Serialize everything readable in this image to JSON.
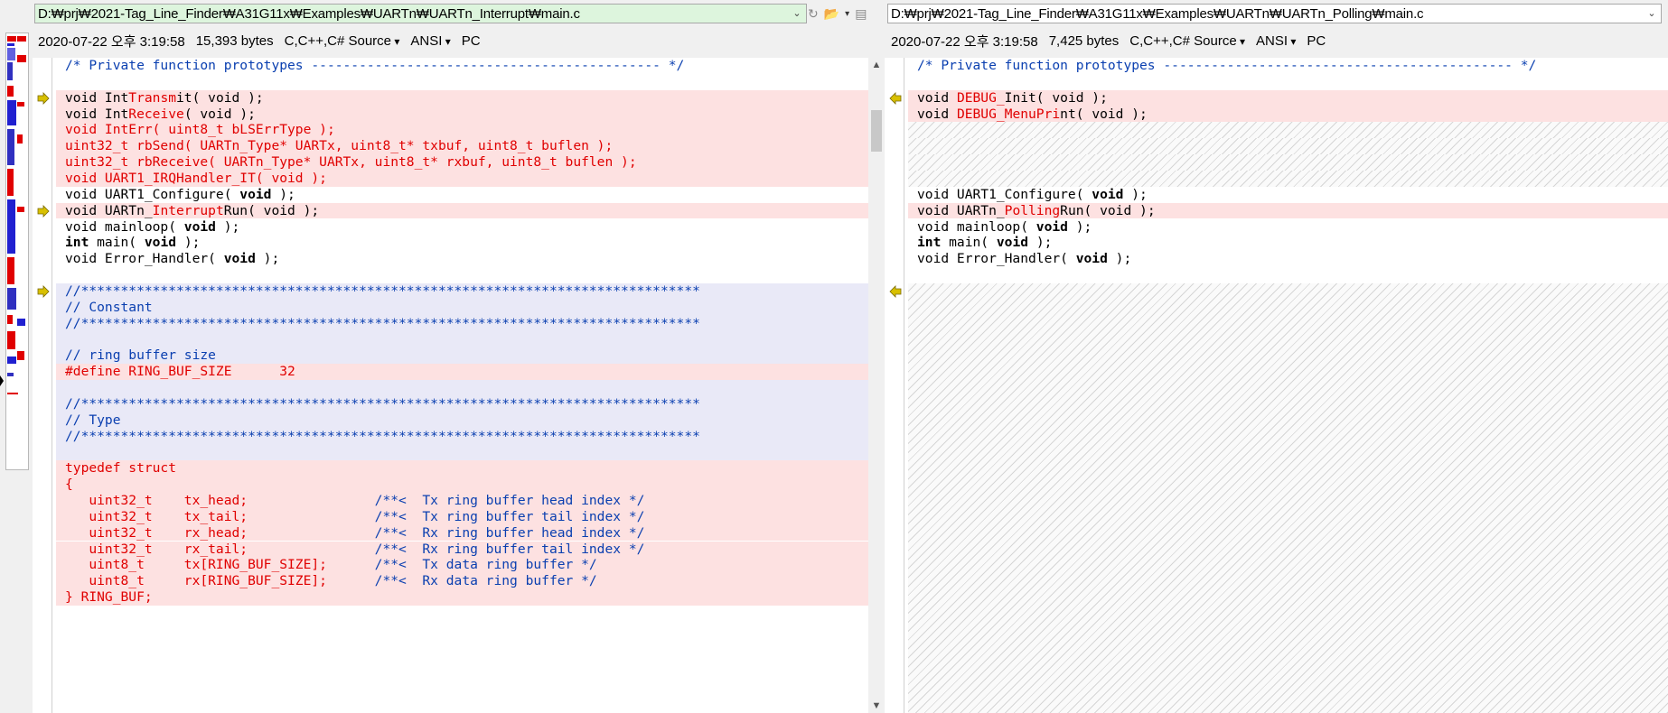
{
  "left": {
    "path": "D:₩prj₩2021-Tag_Line_Finder₩A31G11x₩Examples₩UARTn₩UARTn_Interrupt₩main.c",
    "info": {
      "datetime": "2020-07-22 오후 3:19:58",
      "size": "15,393 bytes",
      "filetype": "C,C++,C# Source",
      "encoding": "ANSI",
      "eol": "PC"
    },
    "lines": [
      {
        "text": "/* Private function prototypes -------------------------------------------- */",
        "color": "#0a3fb0",
        "bg": ""
      },
      {
        "text": "",
        "color": "",
        "bg": ""
      },
      {
        "text": "void IntTransmit( void );",
        "color": "mixed1",
        "bg": "red",
        "marker": "right"
      },
      {
        "text": "void IntReceive( void );",
        "color": "mixed2",
        "bg": "red"
      },
      {
        "text": "void IntErr( uint8_t bLSErrType );",
        "color": "#e00000",
        "bg": "red"
      },
      {
        "text": "uint32_t rbSend( UARTn_Type* UARTx, uint8_t* txbuf, uint8_t buflen );",
        "color": "#e00000",
        "bg": "red"
      },
      {
        "text": "uint32_t rbReceive( UARTn_Type* UARTx, uint8_t* rxbuf, uint8_t buflen );",
        "color": "#e00000",
        "bg": "red"
      },
      {
        "text": "void UART1_IRQHandler_IT( void );",
        "color": "#e00000",
        "bg": "red"
      },
      {
        "text": "void UART1_Configure( void );",
        "color": "kwvoid",
        "bg": ""
      },
      {
        "text": "void UARTn_InterruptRun( void );",
        "color": "mixed3",
        "bg": "red",
        "marker": "right"
      },
      {
        "text": "void mainloop( void );",
        "color": "kwvoid",
        "bg": ""
      },
      {
        "text": "int main( void );",
        "color": "kwint",
        "bg": ""
      },
      {
        "text": "void Error_Handler( void );",
        "color": "kwvoid",
        "bg": ""
      },
      {
        "text": "",
        "color": "",
        "bg": ""
      },
      {
        "text": "//******************************************************************************",
        "color": "#0a3fb0",
        "bg": "blue",
        "marker": "right"
      },
      {
        "text": "// Constant",
        "color": "#0a3fb0",
        "bg": "blue"
      },
      {
        "text": "//******************************************************************************",
        "color": "#0a3fb0",
        "bg": "blue"
      },
      {
        "text": "",
        "color": "",
        "bg": "blue"
      },
      {
        "text": "// ring buffer size",
        "color": "#0a3fb0",
        "bg": "blue"
      },
      {
        "text": "#define RING_BUF_SIZE      32",
        "color": "#e00000",
        "bg": "red"
      },
      {
        "text": "",
        "color": "",
        "bg": "blue"
      },
      {
        "text": "//******************************************************************************",
        "color": "#0a3fb0",
        "bg": "blue"
      },
      {
        "text": "// Type",
        "color": "#0a3fb0",
        "bg": "blue"
      },
      {
        "text": "//******************************************************************************",
        "color": "#0a3fb0",
        "bg": "blue"
      },
      {
        "text": "",
        "color": "",
        "bg": "blue"
      },
      {
        "text": "typedef struct",
        "color": "#e00000",
        "bg": "red"
      },
      {
        "text": "{",
        "color": "#e00000",
        "bg": "red"
      },
      {
        "text": "   uint32_t    tx_head;                /**<  Tx ring buffer head index */",
        "color": "split",
        "bg": "red"
      },
      {
        "text": "   uint32_t    tx_tail;                /**<  Tx ring buffer tail index */",
        "color": "split",
        "bg": "red"
      },
      {
        "text": "   uint32_t    rx_head;                /**<  Rx ring buffer head index */",
        "color": "split",
        "bg": "red"
      },
      {
        "text": "   uint32_t    rx_tail;                /**<  Rx ring buffer tail index */",
        "color": "split",
        "bg": "red"
      },
      {
        "text": "   uint8_t     tx[RING_BUF_SIZE];      /**<  Tx data ring buffer */",
        "color": "split",
        "bg": "red"
      },
      {
        "text": "   uint8_t     rx[RING_BUF_SIZE];      /**<  Rx data ring buffer */",
        "color": "split",
        "bg": "red"
      },
      {
        "text": "} RING_BUF;",
        "color": "#e00000",
        "bg": "red"
      },
      {
        "text": "",
        "color": "",
        "bg": ""
      }
    ]
  },
  "right": {
    "path": "D:₩prj₩2021-Tag_Line_Finder₩A31G11x₩Examples₩UARTn₩UARTn_Polling₩main.c",
    "info": {
      "datetime": "2020-07-22 오후 3:19:58",
      "size": "7,425 bytes",
      "filetype": "C,C++,C# Source",
      "encoding": "ANSI",
      "eol": "PC"
    },
    "lines": [
      {
        "text": "/* Private function prototypes -------------------------------------------- */",
        "color": "#0a3fb0",
        "bg": ""
      },
      {
        "text": "",
        "color": "",
        "bg": ""
      },
      {
        "text": "void DEBUG_Init( void );",
        "color": "mixedR1",
        "bg": "red",
        "marker": "left"
      },
      {
        "text": "void DEBUG_MenuPrint( void );",
        "color": "mixedR2",
        "bg": "red"
      },
      {
        "text": "",
        "color": "",
        "bg": "hatch"
      },
      {
        "text": "",
        "color": "",
        "bg": "hatch"
      },
      {
        "text": "",
        "color": "",
        "bg": "hatch"
      },
      {
        "text": "",
        "color": "",
        "bg": "hatch"
      },
      {
        "text": "void UART1_Configure( void );",
        "color": "kwvoid",
        "bg": ""
      },
      {
        "text": "void UARTn_PollingRun( void );",
        "color": "mixedR3",
        "bg": "red"
      },
      {
        "text": "void mainloop( void );",
        "color": "kwvoid",
        "bg": ""
      },
      {
        "text": "int main( void );",
        "color": "kwint",
        "bg": ""
      },
      {
        "text": "void Error_Handler( void );",
        "color": "kwvoid",
        "bg": ""
      },
      {
        "text": "",
        "color": "",
        "bg": ""
      },
      {
        "text": "",
        "color": "",
        "bg": "hatch",
        "marker": "left"
      }
    ]
  },
  "colors": {
    "comment": "#0a3fb0",
    "diff_text": "#e00000",
    "diff_bg": "#fde1e1",
    "moved_bg": "#e9e9f7",
    "path_active_bg": "#ddf5dd",
    "marker": "#d8c000"
  }
}
